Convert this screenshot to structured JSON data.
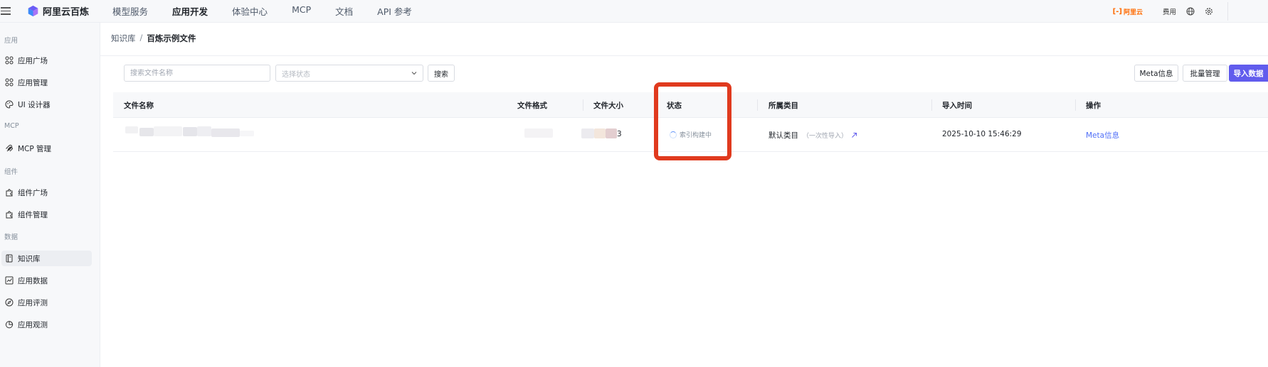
{
  "topbar": {
    "logo_text": "阿里云百炼",
    "nav": [
      {
        "label": "模型服务",
        "active": false
      },
      {
        "label": "应用开发",
        "active": true
      },
      {
        "label": "体验中心",
        "active": false
      },
      {
        "label": "MCP",
        "active": false
      },
      {
        "label": "文档",
        "active": false
      },
      {
        "label": "API 参考",
        "active": false
      }
    ],
    "brand_badge": "阿里云",
    "fees_label": "费用",
    "icons": [
      "globe-icon",
      "gear-icon"
    ]
  },
  "sidebar": {
    "groups": [
      {
        "label": "应用",
        "items": [
          {
            "label": "应用广场",
            "icon": "apps-icon"
          },
          {
            "label": "应用管理",
            "icon": "apps-icon"
          },
          {
            "label": "UI 设计器",
            "icon": "palette-icon"
          }
        ]
      },
      {
        "label": "MCP",
        "items": [
          {
            "label": "MCP 管理",
            "icon": "mcp-icon"
          }
        ]
      },
      {
        "label": "组件",
        "items": [
          {
            "label": "组件广场",
            "icon": "plugin-icon"
          },
          {
            "label": "组件管理",
            "icon": "plugin-icon"
          }
        ]
      },
      {
        "label": "数据",
        "items": [
          {
            "label": "知识库",
            "icon": "book-icon",
            "active": true
          },
          {
            "label": "应用数据",
            "icon": "chart-icon"
          },
          {
            "label": "应用评测",
            "icon": "compass-icon"
          },
          {
            "label": "应用观测",
            "icon": "pie-icon"
          }
        ]
      }
    ]
  },
  "breadcrumb": {
    "parent": "知识库",
    "separator": "/",
    "current": "百炼示例文件"
  },
  "toolbar": {
    "search_placeholder": "搜索文件名称",
    "status_placeholder": "选择状态",
    "search_button": "搜索",
    "meta_button": "Meta信息",
    "batch_button": "批量管理",
    "import_button": "导入数据"
  },
  "table": {
    "headers": {
      "name": "文件名称",
      "format": "文件格式",
      "size": "文件大小",
      "status": "状态",
      "category": "所属类目",
      "import_time": "导入时间",
      "actions": "操作"
    },
    "rows": [
      {
        "size_suffix": "3",
        "status": "索引构建中",
        "category": "默认类目",
        "category_note": "（一次性导入）",
        "import_time": "2025-10-10 15:46:29",
        "action": "Meta信息"
      }
    ]
  },
  "colors": {
    "accent": "#615ced",
    "highlight": "#e03a1e",
    "link": "#4f6ef7"
  }
}
